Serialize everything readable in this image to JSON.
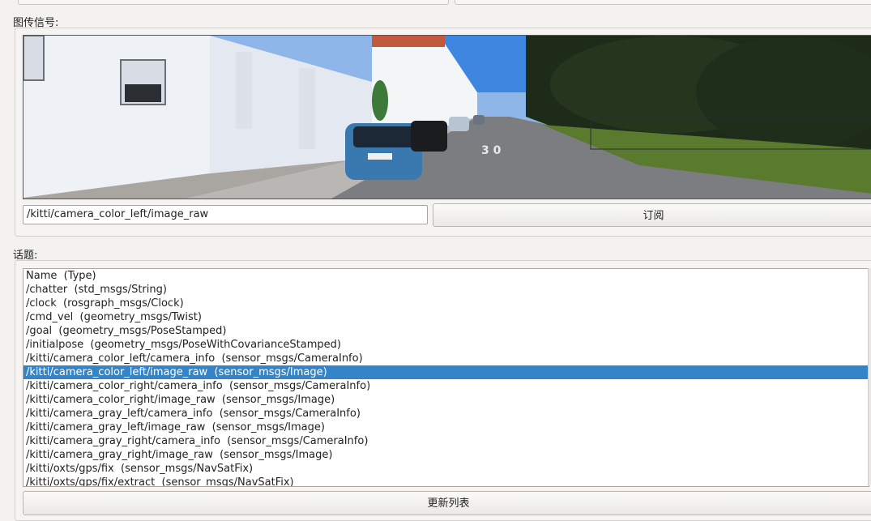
{
  "image_group": {
    "label": "图传信号:"
  },
  "image_topic_input": {
    "value": "/kitti/camera_color_left/image_raw"
  },
  "subscribe_button": {
    "label": "订阅"
  },
  "topics_group": {
    "label": "话题:"
  },
  "topics": [
    {
      "text": "Name  (Type)",
      "selected": false
    },
    {
      "text": "/chatter  (std_msgs/String)",
      "selected": false
    },
    {
      "text": "/clock  (rosgraph_msgs/Clock)",
      "selected": false
    },
    {
      "text": "/cmd_vel  (geometry_msgs/Twist)",
      "selected": false
    },
    {
      "text": "/goal  (geometry_msgs/PoseStamped)",
      "selected": false
    },
    {
      "text": "/initialpose  (geometry_msgs/PoseWithCovarianceStamped)",
      "selected": false
    },
    {
      "text": "/kitti/camera_color_left/camera_info  (sensor_msgs/CameraInfo)",
      "selected": false
    },
    {
      "text": "/kitti/camera_color_left/image_raw  (sensor_msgs/Image)",
      "selected": true
    },
    {
      "text": "/kitti/camera_color_right/camera_info  (sensor_msgs/CameraInfo)",
      "selected": false
    },
    {
      "text": "/kitti/camera_color_right/image_raw  (sensor_msgs/Image)",
      "selected": false
    },
    {
      "text": "/kitti/camera_gray_left/camera_info  (sensor_msgs/CameraInfo)",
      "selected": false
    },
    {
      "text": "/kitti/camera_gray_left/image_raw  (sensor_msgs/Image)",
      "selected": false
    },
    {
      "text": "/kitti/camera_gray_right/camera_info  (sensor_msgs/CameraInfo)",
      "selected": false
    },
    {
      "text": "/kitti/camera_gray_right/image_raw  (sensor_msgs/Image)",
      "selected": false
    },
    {
      "text": "/kitti/oxts/gps/fix  (sensor_msgs/NavSatFix)",
      "selected": false
    },
    {
      "text": "/kitti/oxts/gps/fix/extract  (sensor_msgs/NavSatFix)",
      "selected": false
    }
  ],
  "refresh_button": {
    "label": "更新列表"
  },
  "colors": {
    "selection": "#3584c8",
    "window_bg": "#f3f2f0"
  }
}
